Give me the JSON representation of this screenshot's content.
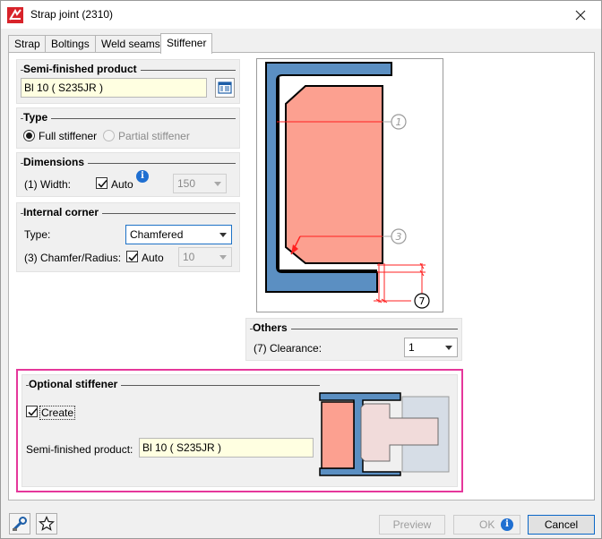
{
  "window": {
    "title": "Strap joint (2310)"
  },
  "tabs": [
    {
      "label": "Strap"
    },
    {
      "label": "Boltings"
    },
    {
      "label": "Weld seams"
    },
    {
      "label": "Stiffener",
      "active": true
    }
  ],
  "semi_finished": {
    "title": "Semi-finished product",
    "value": "Bl 10  ( S235JR )"
  },
  "type": {
    "title": "Type",
    "full_label": "Full stiffener",
    "partial_label": "Partial stiffener",
    "selected": "full"
  },
  "dimensions": {
    "title": "Dimensions",
    "width_label": "(1) Width:",
    "auto_label": "Auto",
    "auto_checked": true,
    "width_value": "150"
  },
  "internal_corner": {
    "title": "Internal corner",
    "type_label": "Type:",
    "type_value": "Chamfered",
    "chamfer_label": "(3) Chamfer/Radius:",
    "auto_label": "Auto",
    "auto_checked": true,
    "chamfer_value": "10"
  },
  "others": {
    "title": "Others",
    "clearance_label": "(7) Clearance:",
    "clearance_value": "1"
  },
  "optional_stiffener": {
    "title": "Optional stiffener",
    "create_label": "Create",
    "create_checked": true,
    "product_label": "Semi-finished product:",
    "product_value": "Bl 10  ( S235JR )"
  },
  "diagram": {
    "marker_1": "1",
    "marker_3": "3",
    "marker_7": "7"
  },
  "footer": {
    "preview_label": "Preview",
    "ok_label": "OK",
    "cancel_label": "Cancel"
  },
  "colors": {
    "profile_blue": "#5b8fc2",
    "stiffener_red": "#fca090",
    "highlight_pink": "#e5379b",
    "input_yellow": "#ffffe1"
  },
  "icons": {
    "app": "strap-joint-app-icon",
    "close": "close-icon",
    "library": "catalog-icon",
    "info": "info-icon",
    "settings": "settings-icon",
    "favorite": "star-icon"
  }
}
